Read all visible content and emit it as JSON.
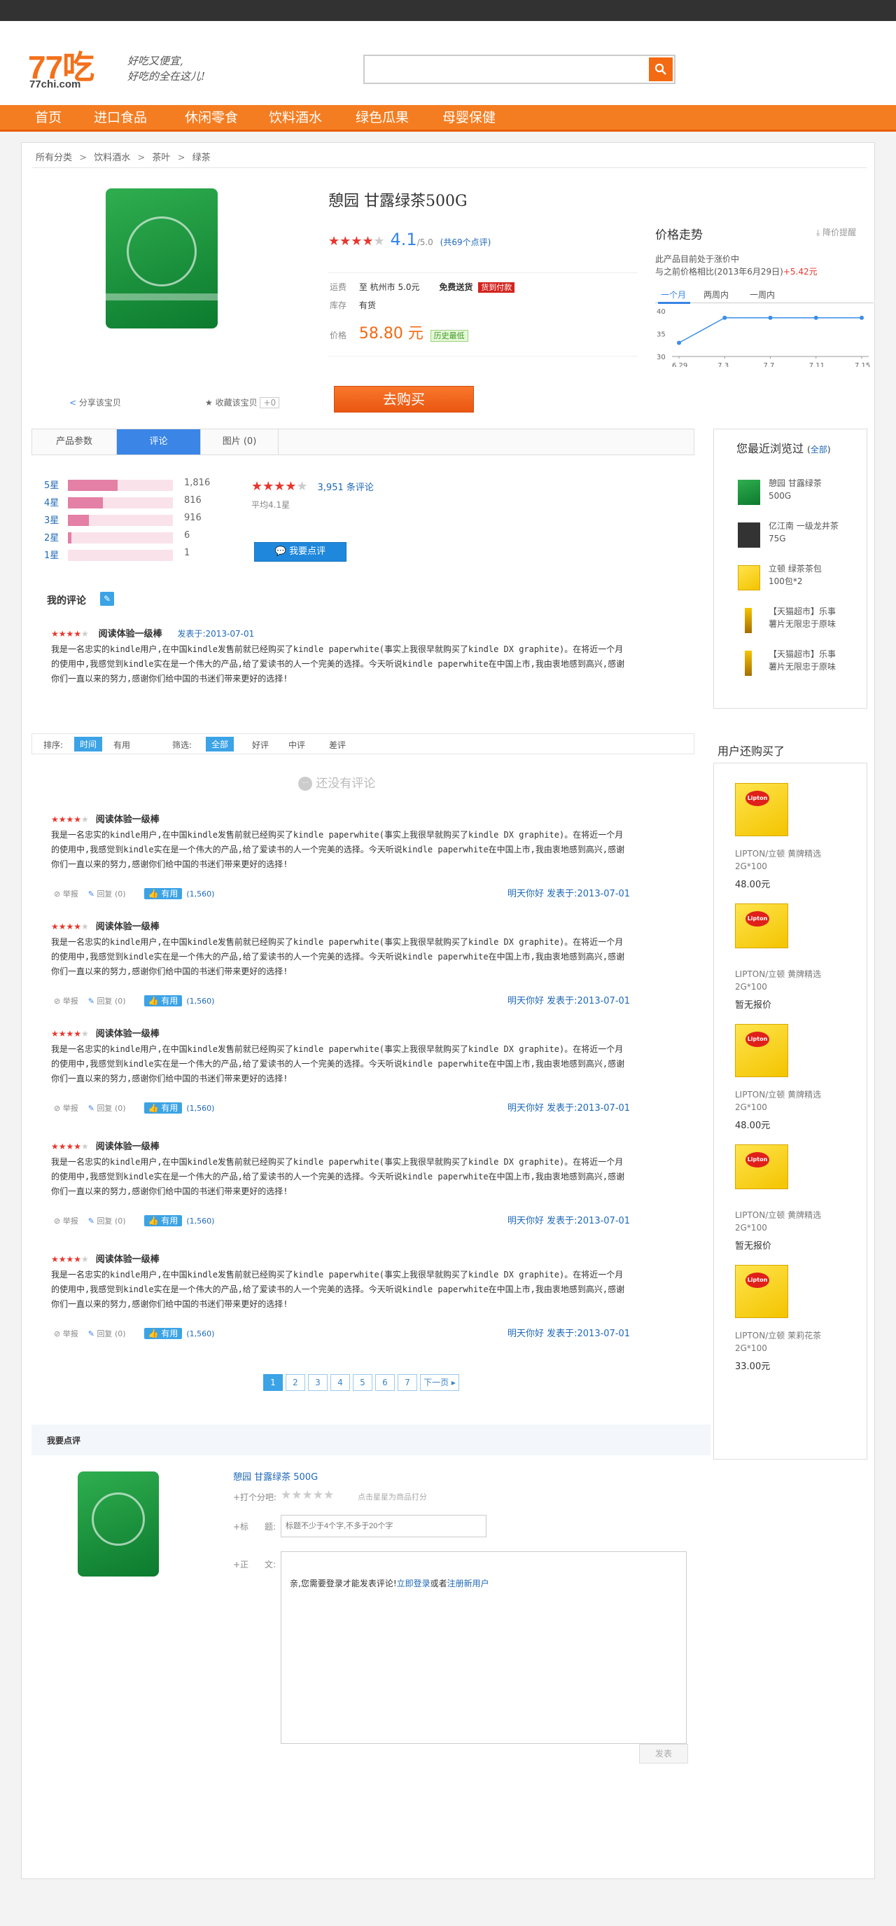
{
  "brand": {
    "logo_big": "77吃",
    "logo_small": "77chi.com",
    "slogan1": "好吃又便宜,",
    "slogan2": "好吃的全在这儿!"
  },
  "nav": [
    "首页",
    "进口食品",
    "休闲零食",
    "饮料酒水",
    "绿色瓜果",
    "母婴保健"
  ],
  "breadcrumb": [
    "所有分类",
    ">",
    "饮料酒水",
    ">",
    "茶叶",
    ">",
    "绿茶"
  ],
  "product": {
    "title": "憩园  甘露绿茶500G",
    "rating_value": "4.1",
    "rating_max": "/5.0",
    "rating_count": "(共69个点评)",
    "stars": 4,
    "ship_label": "运费",
    "ship_text": "至 杭州市 5.0元",
    "free_ship": "免费送货",
    "cod_badge": "货到付款",
    "stock_label": "库存",
    "stock_value": "有货",
    "price_label": "价格",
    "price": "58.80 元",
    "lowest_badge": "历史最低",
    "share": "分享该宝贝",
    "fav": "收藏该宝贝",
    "fav_count": "+0",
    "buy": "去购买"
  },
  "price_trend": {
    "title": "价格走势",
    "alert": "降价提醒",
    "line1": "此产品目前处于涨价中",
    "line2a": "与之前价格相比(2013年6月29日)",
    "line2b": "+5.42元",
    "tabs": [
      "一个月",
      "两周内",
      "一周内"
    ]
  },
  "chart_data": {
    "type": "line",
    "x": [
      "6.29",
      "7.3",
      "7.7",
      "7.11",
      "7.15"
    ],
    "series": [
      {
        "values": [
          33,
          38.5,
          38.5,
          38.5,
          38.5
        ]
      }
    ],
    "yticks": [
      40,
      35,
      30
    ],
    "ylim": [
      30,
      40
    ],
    "accent": "#3a8ee6"
  },
  "tabs": {
    "params": "产品参数",
    "reviews": "评论",
    "images": "图片 (0)"
  },
  "rating_dist": [
    {
      "label": "5星",
      "count": "1,816",
      "frac": 0.47
    },
    {
      "label": "4星",
      "count": "816",
      "frac": 0.33
    },
    {
      "label": "3星",
      "count": "916",
      "frac": 0.2
    },
    {
      "label": "2星",
      "count": "6",
      "frac": 0.03
    },
    {
      "label": "1星",
      "count": "1",
      "frac": 0.0
    }
  ],
  "summary": {
    "count": "3,951 条评论",
    "avg": "平均4.1星",
    "write_btn": "我要点评"
  },
  "my_review": {
    "title": "我的评论",
    "level": "阅读体验一级棒",
    "date": "发表于:2013-07-01"
  },
  "review_text": "我是一名忠实的kindle用户,在中国kindle发售前就已经购买了kindle paperwhite(事实上我很早就购买了kindle DX graphite)。在将近一个月的使用中,我感觉到kindle实在是一个伟大的产品,给了爱读书的人一个完美的选择。今天听说kindle paperwhite在中国上市,我由衷地感到高兴,感谢你们一直以来的努力,感谢你们给中国的书迷们带来更好的选择!",
  "filter": {
    "sort_label": "排序:",
    "sort1": "时间",
    "sort2": "有用",
    "filter_label": "筛选:",
    "f_all": "全部",
    "f_good": "好评",
    "f_mid": "中评",
    "f_bad": "差评"
  },
  "empty": "还没有评论",
  "review_item": {
    "level": "阅读体验一级棒",
    "report": "举报",
    "reply": "回复",
    "reply_count": "(0)",
    "helpful": "有用",
    "helpful_count": "(1,560)",
    "author_date": "明天你好 发表于:2013-07-01"
  },
  "pagination": {
    "pages": [
      "1",
      "2",
      "3",
      "4",
      "5",
      "6",
      "7"
    ],
    "next": "下一页"
  },
  "write": {
    "title": "我要点评",
    "product": "憩园 甘露绿茶 500G",
    "score_label": "+打个分吧:",
    "score_hint": "点击星星为商品打分",
    "title_label": "+标      题:",
    "title_placeholder": "标题不少于4个字,不多于20个字",
    "body_label": "+正      文:",
    "login_prefix": "亲,您需要登录才能发表评论!",
    "login_link": "立即登录",
    "or": "或者",
    "register_link": "注册新用户",
    "submit": "发表"
  },
  "recent": {
    "title": "您最近浏览过",
    "all": "全部",
    "items": [
      {
        "name1": "憩园 甘露绿茶",
        "name2": "500G"
      },
      {
        "name1": "亿江南 一级龙井茶",
        "name2": "75G"
      },
      {
        "name1": "立顿 绿茶茶包",
        "name2": "100包*2"
      },
      {
        "name1": "【天猫超市】乐事",
        "name2": "薯片无限忠于原味"
      },
      {
        "name1": "【天猫超市】乐事",
        "name2": "薯片无限忠于原味"
      }
    ]
  },
  "also": {
    "title": "用户还购买了",
    "items": [
      {
        "name1": "LIPTON/立顿 黄牌精选",
        "name2": "2G*100",
        "price": "48.00元"
      },
      {
        "name1": "LIPTON/立顿 黄牌精选",
        "name2": "2G*100",
        "price": "暂无报价"
      },
      {
        "name1": "LIPTON/立顿 黄牌精选",
        "name2": "2G*100",
        "price": "48.00元"
      },
      {
        "name1": "LIPTON/立顿 黄牌精选",
        "name2": "2G*100",
        "price": "暂无报价"
      },
      {
        "name1": "LIPTON/立顿 茉莉花茶",
        "name2": "2G*100",
        "price": "33.00元"
      }
    ]
  }
}
